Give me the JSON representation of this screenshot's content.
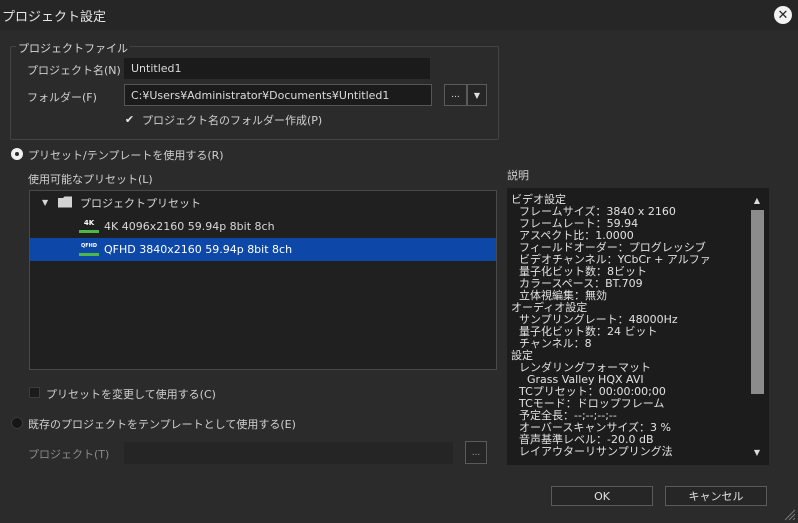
{
  "window": {
    "title": "プロジェクト設定",
    "close_glyph": "✕"
  },
  "project_file": {
    "group_label": "プロジェクトファイル",
    "name_label": "プロジェクト名(N)",
    "name_value": "Untitled1",
    "folder_label": "フォルダー(F)",
    "folder_value": "C:¥Users¥Administrator¥Documents¥Untitled1",
    "browse_label": "...",
    "dropdown_glyph": "▼",
    "create_folder_label": "プロジェクト名のフォルダー作成(P)",
    "create_folder_checked": true,
    "check_glyph": "✔"
  },
  "use_preset": {
    "radio_label": "プリセット/テンプレートを使用する(R)",
    "selected": true,
    "available_label": "使用可能なプリセット(L)",
    "tree": {
      "root_label": "プロジェクトプリセット",
      "expand_glyph": "▼",
      "items": [
        {
          "badge": "4K",
          "label": "4K 4096x2160 59.94p 8bit 8ch",
          "selected": false
        },
        {
          "badge": "QFHD",
          "label": "QFHD 3840x2160 59.94p 8bit 8ch",
          "selected": true
        }
      ]
    },
    "modify_label": "プリセットを変更して使用する(C)",
    "modify_checked": false
  },
  "use_existing": {
    "radio_label": "既存のプロジェクトをテンプレートとして使用する(E)",
    "selected": false,
    "project_label": "プロジェクト(T)",
    "project_value": "",
    "browse_label": "..."
  },
  "description": {
    "label": "説明",
    "lines": [
      "ビデオ設定",
      "フレームサイズ：3840 x 2160",
      "フレームレート：59.94",
      "アスペクト比：1.0000",
      "フィールドオーダー：プログレッシブ",
      "ビデオチャンネル：YCbCr + アルファ",
      "量子化ビット数：8ビット",
      "カラースペース：BT.709",
      "立体視編集：無効",
      "オーディオ設定",
      "サンプリングレート：48000Hz",
      "量子化ビット数：24 ビット",
      "チャンネル：8",
      "設定",
      "レンダリングフォーマット",
      "Grass Valley HQX AVI",
      "TCプリセット：00:00:00;00",
      "TCモード：ドロップフレーム",
      "予定全長：--;--;--;--",
      "オーバースキャンサイズ：3 %",
      "音声基準レベル：-20.0 dB",
      "レイアウターリサンプリング法"
    ],
    "scroll_up_glyph": "▲",
    "scroll_down_glyph": "▼"
  },
  "buttons": {
    "ok_label": "OK",
    "cancel_label": "キャンセル"
  },
  "colors": {
    "background": "#2b2b2b",
    "titlebar": "#262626",
    "selection": "#0d47a8",
    "field": "#1b1b1b"
  }
}
